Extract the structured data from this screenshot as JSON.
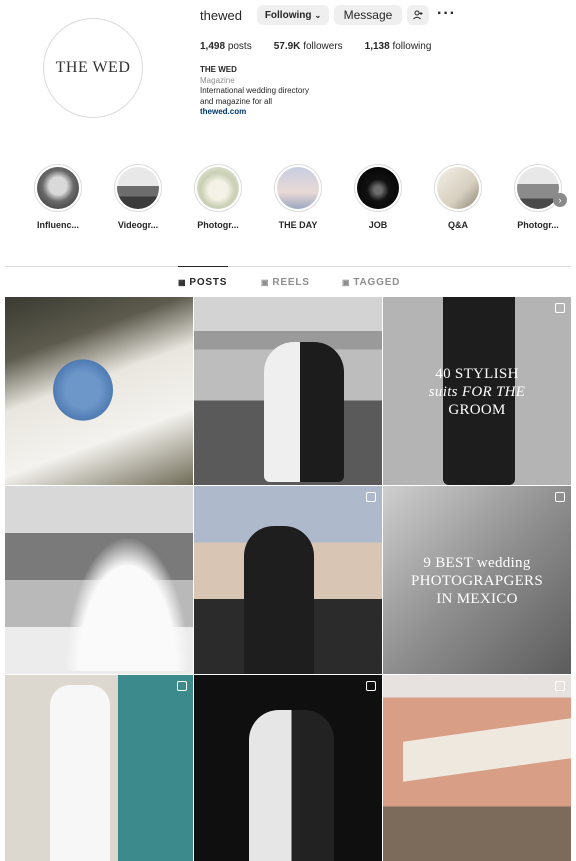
{
  "profile": {
    "avatar_text": "THE WED",
    "username": "thewed",
    "following_label": "Following",
    "message_label": "Message",
    "posts": "1,498",
    "posts_label": "posts",
    "followers": "57.9K",
    "followers_label": "followers",
    "following_count": "1,138",
    "following_count_label": "following",
    "name": "THE WED",
    "category": "Magazine",
    "bio_line1": "International wedding directory",
    "bio_line2": "and magazine for all",
    "link": "thewed.com"
  },
  "highlights": [
    {
      "label": "Influenc...",
      "icon": "dress-photo"
    },
    {
      "label": "Videogr...",
      "icon": "car-photo"
    },
    {
      "label": "Photogr...",
      "icon": "bouquet-photo"
    },
    {
      "label": "THE DAY",
      "icon": "tower-photo"
    },
    {
      "label": "JOB",
      "icon": "screen-photo"
    },
    {
      "label": "Q&A",
      "icon": "veil-photo"
    },
    {
      "label": "Photogr...",
      "icon": "couple-photo"
    }
  ],
  "tabs": {
    "posts": "POSTS",
    "reels": "REELS",
    "tagged": "TAGGED"
  },
  "posts": [
    {
      "overlay_l1": "",
      "overlay_l2": "",
      "overlay_l3": ""
    },
    {
      "overlay_l1": "",
      "overlay_l2": "",
      "overlay_l3": ""
    },
    {
      "overlay_l1": "40 STYLISH",
      "overlay_l2": "suits FOR THE",
      "overlay_l3": "GROOM"
    },
    {
      "overlay_l1": "",
      "overlay_l2": "",
      "overlay_l3": ""
    },
    {
      "overlay_l1": "",
      "overlay_l2": "",
      "overlay_l3": ""
    },
    {
      "overlay_l1": "9 BEST wedding",
      "overlay_l2": "PHOTOGRAPGERS",
      "overlay_l3": "IN MEXICO"
    },
    {
      "overlay_l1": "",
      "overlay_l2": "",
      "overlay_l3": ""
    },
    {
      "overlay_l1": "",
      "overlay_l2": "",
      "overlay_l3": ""
    },
    {
      "overlay_l1": "",
      "overlay_l2": "",
      "overlay_l3": ""
    }
  ]
}
